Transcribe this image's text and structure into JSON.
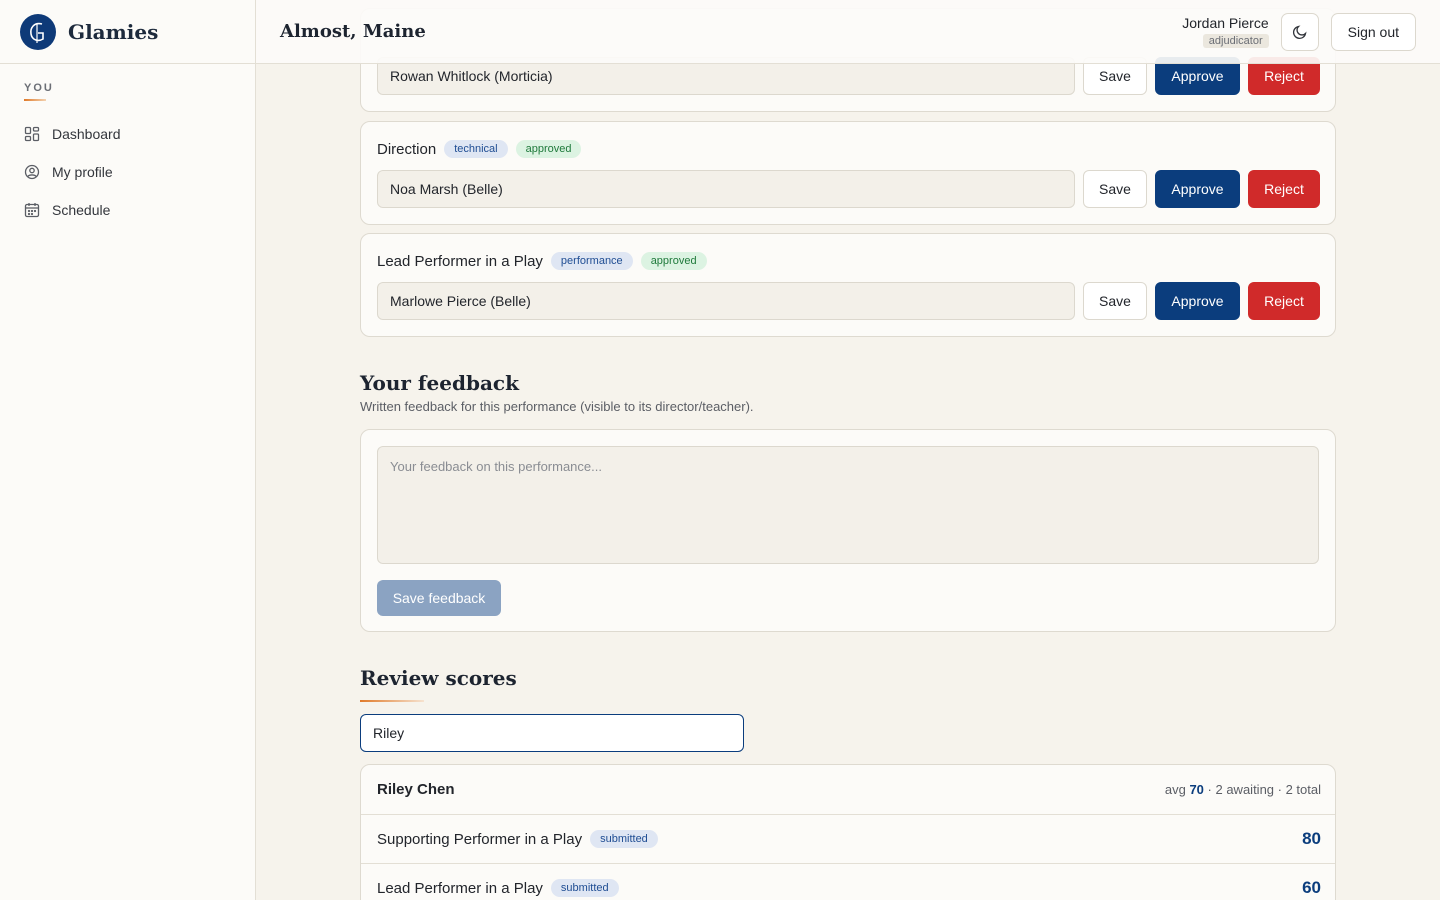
{
  "brand": {
    "name": "Glamies"
  },
  "sidebar": {
    "section_heading": "YOU",
    "items": [
      {
        "label": "Dashboard",
        "icon": "dashboard-icon"
      },
      {
        "label": "My profile",
        "icon": "profile-icon"
      },
      {
        "label": "Schedule",
        "icon": "calendar-icon"
      }
    ]
  },
  "header": {
    "title": "Almost, Maine",
    "user_name": "Jordan Pierce",
    "user_role": "adjudicator",
    "theme_icon": "moon-icon",
    "signout_label": "Sign out"
  },
  "awards": [
    {
      "name": "",
      "category": "",
      "status": "",
      "nominee": "Rowan Whitlock (Morticia)",
      "save": "Save",
      "approve": "Approve",
      "reject": "Reject"
    },
    {
      "name": "Direction",
      "category": "technical",
      "status": "approved",
      "nominee": "Noa Marsh (Belle)",
      "save": "Save",
      "approve": "Approve",
      "reject": "Reject"
    },
    {
      "name": "Lead Performer in a Play",
      "category": "performance",
      "status": "approved",
      "nominee": "Marlowe Pierce (Belle)",
      "save": "Save",
      "approve": "Approve",
      "reject": "Reject"
    }
  ],
  "feedback": {
    "title": "Your feedback",
    "subtitle": "Written feedback for this performance (visible to its director/teacher).",
    "placeholder": "Your feedback on this performance...",
    "save_label": "Save feedback"
  },
  "review": {
    "title": "Review scores",
    "search_value": "Riley",
    "scorer": {
      "name": "Riley Chen",
      "avg_prefix": "avg",
      "avg": "70",
      "rest": "· 2 awaiting · 2 total"
    },
    "rows": [
      {
        "award": "Supporting Performer in a Play",
        "status": "submitted",
        "score": "80"
      },
      {
        "award": "Lead Performer in a Play",
        "status": "submitted",
        "score": "60"
      }
    ]
  },
  "colors": {
    "accent": "#0b3d7d",
    "reject": "#d02a2a",
    "approved_bg": "#dcf3e2",
    "tag_bg": "#dfe6f3",
    "underline": "#e07a2a"
  }
}
